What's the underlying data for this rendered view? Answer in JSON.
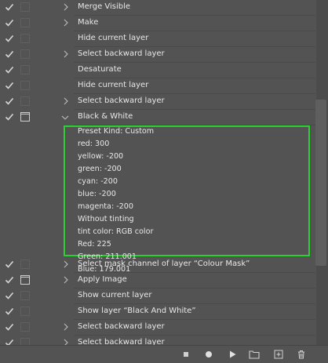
{
  "actions": [
    {
      "label": "Merge Visible",
      "checked": true,
      "dialog": false,
      "expandable": true
    },
    {
      "label": "Make",
      "checked": true,
      "dialog": false,
      "expandable": true
    },
    {
      "label": "Hide current layer",
      "checked": true,
      "dialog": false,
      "expandable": false
    },
    {
      "label": "Select backward layer",
      "checked": true,
      "dialog": false,
      "expandable": true
    },
    {
      "label": "Desaturate",
      "checked": true,
      "dialog": false,
      "expandable": false
    },
    {
      "label": "Hide current layer",
      "checked": true,
      "dialog": false,
      "expandable": false
    },
    {
      "label": "Select backward layer",
      "checked": true,
      "dialog": false,
      "expandable": true
    },
    {
      "label": "Black & White",
      "checked": true,
      "dialog": true,
      "expandable": true,
      "expanded": true
    },
    {
      "label": "Select mask channel of layer “Colour Mask”",
      "checked": true,
      "dialog": false,
      "expandable": true
    },
    {
      "label": "Apply Image",
      "checked": true,
      "dialog": true,
      "expandable": true
    },
    {
      "label": "Show current layer",
      "checked": true,
      "dialog": false,
      "expandable": false
    },
    {
      "label": "Show layer “Black And White”",
      "checked": true,
      "dialog": false,
      "expandable": false
    },
    {
      "label": "Select backward layer",
      "checked": true,
      "dialog": false,
      "expandable": true
    },
    {
      "label": "Select backward layer",
      "checked": true,
      "dialog": false,
      "expandable": true
    }
  ],
  "black_white_details": [
    "Preset Kind: Custom",
    "red: 300",
    "yellow: -200",
    "green: -200",
    "cyan: -200",
    "blue: -200",
    "magenta: -200",
    "Without tinting",
    "tint color: RGB color",
    "Red: 225",
    "Green: 211.001",
    "Blue: 179.001"
  ],
  "toolbar": {
    "buttons": [
      {
        "name": "stop-button",
        "icon": "square-icon"
      },
      {
        "name": "record-button",
        "icon": "circle-icon"
      },
      {
        "name": "play-button",
        "icon": "play-icon"
      },
      {
        "name": "new-set-button",
        "icon": "folder-icon"
      },
      {
        "name": "new-action-button",
        "icon": "plus-square-icon"
      },
      {
        "name": "delete-button",
        "icon": "trash-icon"
      }
    ]
  },
  "colors": {
    "panel_bg": "#535353",
    "highlight_border": "#28d22f",
    "text": "#e8e8e8"
  }
}
